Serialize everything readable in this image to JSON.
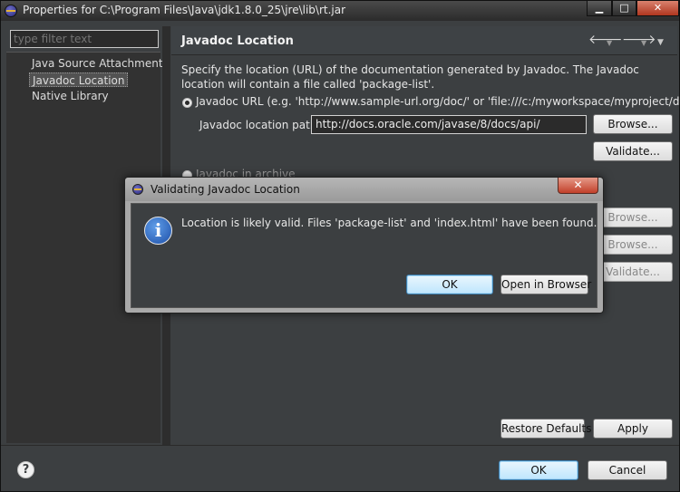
{
  "window": {
    "title": "Properties for C:\\Program Files\\Java\\jdk1.8.0_25\\jre\\lib\\rt.jar",
    "minimize": "▁",
    "maximize": "□",
    "close": "✕"
  },
  "sidebar": {
    "filter_placeholder": "type filter text",
    "items": [
      {
        "label": "Java Source Attachment"
      },
      {
        "label": "Javadoc Location",
        "selected": true
      },
      {
        "label": "Native Library"
      }
    ]
  },
  "page": {
    "title": "Javadoc Location",
    "description": "Specify the location (URL) of the documentation generated by Javadoc. The Javadoc location will contain a file called 'package-list'.",
    "url_option_label": "Javadoc URL (e.g. 'http://www.sample-url.org/doc/' or 'file:///c:/myworkspace/myproject/doc')",
    "location_label": "Javadoc location path:",
    "location_value": "http://docs.oracle.com/javase/8/docs/api/",
    "browse_label": "Browse...",
    "validate_label": "Validate...",
    "archive_option_label": "Javadoc in archive",
    "restore_defaults_label": "Restore Defaults",
    "apply_label": "Apply"
  },
  "footer": {
    "help": "?",
    "ok_label": "OK",
    "cancel_label": "Cancel"
  },
  "dialog": {
    "title": "Validating Javadoc Location",
    "close": "✕",
    "message": "Location is likely valid. Files 'package-list' and 'index.html' have been found.",
    "ok_label": "OK",
    "open_browser_label": "Open in Browser"
  },
  "icons": {
    "back": "🡐",
    "forward": "🡒",
    "dropdown": "▼",
    "info": "i"
  },
  "colors": {
    "background": "#3c3f41",
    "accent": "#3c7fb1",
    "close_red": "#c2402a"
  }
}
